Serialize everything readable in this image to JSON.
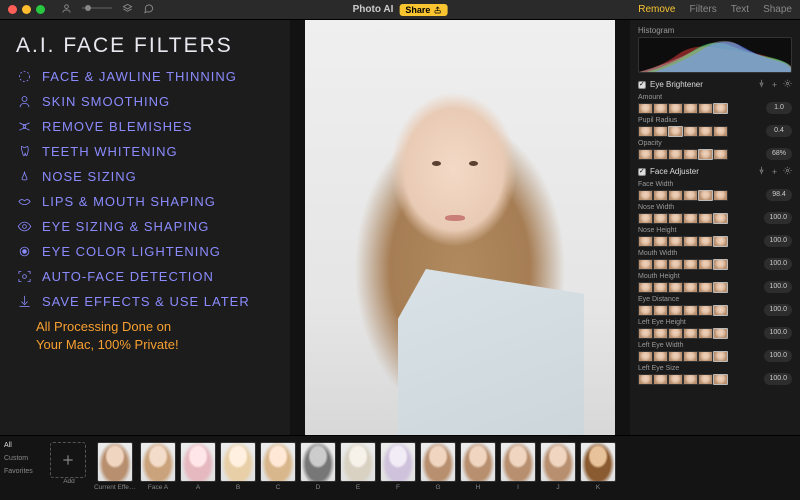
{
  "titlebar": {
    "app_title": "Photo AI",
    "share_label": "Share",
    "tabs": [
      {
        "label": "Remove",
        "active": true
      },
      {
        "label": "Filters",
        "active": false
      },
      {
        "label": "Text",
        "active": false
      },
      {
        "label": "Shape",
        "active": false
      }
    ]
  },
  "features": {
    "title": "A.I. FACE FILTERS",
    "items": [
      {
        "icon": "face-thin-icon",
        "label": "FACE & JAWLINE THINNING"
      },
      {
        "icon": "skin-icon",
        "label": "SKIN SMOOTHING"
      },
      {
        "icon": "blemish-icon",
        "label": "REMOVE BLEMISHES"
      },
      {
        "icon": "tooth-icon",
        "label": "TEETH WHITENING"
      },
      {
        "icon": "nose-icon",
        "label": "NOSE SIZING"
      },
      {
        "icon": "lips-icon",
        "label": "LIPS & MOUTH SHAPING"
      },
      {
        "icon": "eye-shape-icon",
        "label": "EYE SIZING & SHAPING"
      },
      {
        "icon": "eye-color-icon",
        "label": "EYE COLOR LIGHTENING"
      },
      {
        "icon": "detect-icon",
        "label": "AUTO-FACE DETECTION"
      },
      {
        "icon": "save-icon",
        "label": "SAVE EFFECTS & USE LATER"
      }
    ],
    "tagline_l1": "All Processing Done on",
    "tagline_l2": "Your Mac, 100% Private!"
  },
  "right": {
    "histogram_label": "Histogram",
    "panels": [
      {
        "name": "Eye Brightener",
        "checked": true,
        "params": [
          {
            "label": "Amount",
            "value": "1.0",
            "sel": 5
          },
          {
            "label": "Pupil Radius",
            "value": "0.4",
            "sel": 2
          },
          {
            "label": "Opacity",
            "value": "68%",
            "sel": 4
          }
        ]
      },
      {
        "name": "Face Adjuster",
        "checked": true,
        "params": [
          {
            "label": "Face Width",
            "value": "98.4",
            "sel": 4
          },
          {
            "label": "Nose Width",
            "value": "100.0",
            "sel": 5
          },
          {
            "label": "Nose Height",
            "value": "100.0",
            "sel": 5
          },
          {
            "label": "Mouth Width",
            "value": "100.0",
            "sel": 5
          },
          {
            "label": "Mouth Height",
            "value": "100.0",
            "sel": 5
          },
          {
            "label": "Eye Distance",
            "value": "100.0",
            "sel": 5
          },
          {
            "label": "Left Eye Height",
            "value": "100.0",
            "sel": 5
          },
          {
            "label": "Left Eye Width",
            "value": "100.0",
            "sel": 5
          },
          {
            "label": "Left Eye Size",
            "value": "100.0",
            "sel": 5
          }
        ]
      }
    ]
  },
  "bottom": {
    "categories": [
      "All",
      "Custom",
      "Favorites"
    ],
    "add_label": "Add",
    "presets": [
      {
        "label": "Current Effects",
        "skin": "#f0d5c0",
        "hair": "#b89070"
      },
      {
        "label": "Face A",
        "skin": "#f3dcc9",
        "hair": "#caa37c"
      },
      {
        "label": "A",
        "skin": "#ffe6e8",
        "hair": "#e6b8c0"
      },
      {
        "label": "B",
        "skin": "#fff0df",
        "hair": "#e8cfa8"
      },
      {
        "label": "C",
        "skin": "#ffe8d6",
        "hair": "#d9b78c"
      },
      {
        "label": "D",
        "skin": "#cccccc",
        "hair": "#777777"
      },
      {
        "label": "E",
        "skin": "#f6f2ea",
        "hair": "#d9d2c2"
      },
      {
        "label": "F",
        "skin": "#f2ecf6",
        "hair": "#cfc2dc"
      },
      {
        "label": "G",
        "skin": "#f0d5c0",
        "hair": "#b89070"
      },
      {
        "label": "H",
        "skin": "#f0d5c0",
        "hair": "#b89070"
      },
      {
        "label": "I",
        "skin": "#f0d5c0",
        "hair": "#b89070"
      },
      {
        "label": "J",
        "skin": "#f0d5c0",
        "hair": "#b89070"
      },
      {
        "label": "K",
        "skin": "#e8c29a",
        "hair": "#8a5a30"
      }
    ]
  },
  "colors": {
    "accent": "#f8c430",
    "feature": "#8b8bff",
    "tagline": "#f8a030"
  }
}
